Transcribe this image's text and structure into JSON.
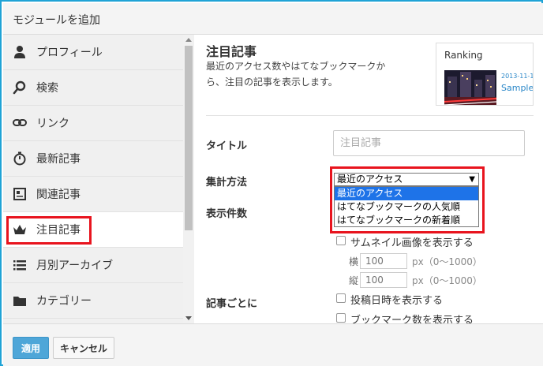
{
  "dialog": {
    "title": "モジュールを追加"
  },
  "sidebar": {
    "items": [
      {
        "label": "プロフィール",
        "icon": "person-icon"
      },
      {
        "label": "検索",
        "icon": "search-icon"
      },
      {
        "label": "リンク",
        "icon": "link-icon"
      },
      {
        "label": "最新記事",
        "icon": "stopwatch-icon"
      },
      {
        "label": "関連記事",
        "icon": "newspaper-icon"
      },
      {
        "label": "注目記事",
        "icon": "crown-icon",
        "active": true
      },
      {
        "label": "月別アーカイブ",
        "icon": "list-icon"
      },
      {
        "label": "カテゴリー",
        "icon": "folder-icon"
      }
    ]
  },
  "module": {
    "title": "注目記事",
    "description": "最近のアクセス数やはてなブックマークから、注目の記事を表示します。",
    "preview": {
      "title": "Ranking",
      "date": "2013-11-1",
      "sample": "Sample"
    }
  },
  "form": {
    "title_label": "タイトル",
    "title_placeholder": "注目記事",
    "method_label": "集計方法",
    "method_selected": "最近のアクセス",
    "method_options": [
      "最近のアクセス",
      "はてなブックマークの人気順",
      "はてなブックマークの新着順"
    ],
    "count_label": "表示件数",
    "thumbnail_label": "サムネイル画像を表示する",
    "width_label": "横",
    "width_value": "100",
    "height_label": "縦",
    "height_value": "100",
    "px_unit": "px（0〜1000）",
    "per_article_label": "記事ごとに",
    "show_date_label": "投稿日時を表示する",
    "show_bookmarks_label": "ブックマーク数を表示する"
  },
  "footer": {
    "apply_label": "適用",
    "cancel_label": "キャンセル"
  },
  "colors": {
    "accent": "#1fa3d6",
    "highlight": "#e8141e",
    "apply_button": "#4ea6d8",
    "selected_option": "#1e73e8"
  }
}
